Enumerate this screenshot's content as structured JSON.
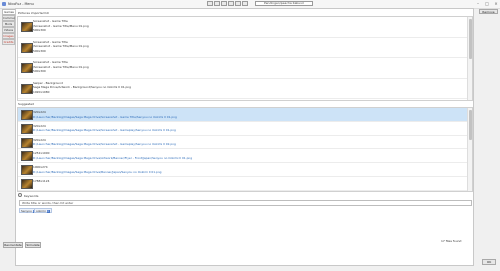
{
  "window": {
    "title": "NicoFuz - Menu",
    "search_text": "Pendingen/peacha Kabuvil"
  },
  "header": {
    "right_button": "Remove"
  },
  "tabs": [
    {
      "label": "Games",
      "active": true,
      "highlight": false
    },
    {
      "label": "Comments",
      "active": false,
      "highlight": false
    },
    {
      "label": "Mods",
      "active": false,
      "highlight": false
    },
    {
      "label": "Videos",
      "active": false,
      "highlight": false
    },
    {
      "label": "Images",
      "active": false,
      "highlight": true
    },
    {
      "label": "Credits",
      "active": false,
      "highlight": true
    }
  ],
  "pictures": {
    "label": "Pictures imported",
    "count": "10"
  },
  "imported_rows": [
    {
      "title": "Screenshot - Game Title",
      "path": "/Screenshot - Game Title/Menu 01.png",
      "size": "500x300"
    },
    {
      "title": "Screenshot - Game Title",
      "path": "/Screenshot - Game Title/Menu 01.png",
      "size": "500x300"
    },
    {
      "title": "Screenshot - Game Title",
      "path": "/Screenshot - Game Title/Menu 01.png",
      "size": "500x300"
    },
    {
      "title": "Swiper - Background",
      "path": "Saga Mega Drive/Artwork - Background/Senyou no Ookimi II 01.png",
      "size": "1920x1080"
    }
  ],
  "suggested": {
    "label": "Suggested",
    "rows": [
      {
        "size": "320x224",
        "path": "D:/Launcher/Backlog/Images/Saga Mega Drive/Screenshot - Game Title/Senyou no Ookimi II 01.png",
        "selected": true
      },
      {
        "size": "320x224",
        "path": "D:/Launcher/Backlog/Images/Saga Mega Drive/Screenshot - Gameplay/Senyou no Ookimi II 01.png",
        "selected": false
      },
      {
        "size": "320x224",
        "path": "D:/Launcher/Backlog/Images/Saga Mega Drive/Screenshot - Gameplay/Senyou no Ookimi II 02.png",
        "selected": false
      },
      {
        "size": "1252x1000",
        "path": "D:/Launcher/Backlog/Images/Saga Mega Drive/Artwork/Banner/Flyer - Front/Japan/Senyou no Ookimi II 01.png",
        "selected": false
      },
      {
        "size": "1900x274",
        "path": "D:/Launcher/Backlog/Images/Saga Mega Drive/Banner/Japan/Senyou no Ookimi II 01.png",
        "selected": false
      },
      {
        "size": "1788x1124",
        "path": "",
        "selected": false
      }
    ]
  },
  "keywords": {
    "label": "Keywords",
    "placeholder": "Write title or words, then hit enter",
    "chips": [
      "Senyou",
      "ookimi"
    ]
  },
  "footer": {
    "count": "17 files found",
    "left_buttons": [
      "Reorientate",
      "Simulate"
    ],
    "ok": "OK"
  }
}
